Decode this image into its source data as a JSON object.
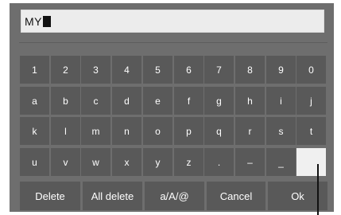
{
  "input": {
    "value": "MY"
  },
  "keyboard": {
    "rows": [
      [
        "1",
        "2",
        "3",
        "4",
        "5",
        "6",
        "7",
        "8",
        "9",
        "0"
      ],
      [
        "a",
        "b",
        "c",
        "d",
        "e",
        "f",
        "g",
        "h",
        "i",
        "j"
      ],
      [
        "k",
        "l",
        "m",
        "n",
        "o",
        "p",
        "q",
        "r",
        "s",
        "t"
      ],
      [
        "u",
        "v",
        "w",
        "x",
        "y",
        "z",
        ".",
        "–",
        "_",
        ""
      ]
    ],
    "selected_key": "row-4-col-10"
  },
  "function_keys": {
    "delete": "Delete",
    "all_delete": "All delete",
    "mode": "a/A/@",
    "cancel": "Cancel",
    "ok": "Ok"
  },
  "colors": {
    "panel": "#6e6e6e",
    "key": "#595959",
    "selected_key": "#f0f0f0",
    "input": "#ececec"
  }
}
